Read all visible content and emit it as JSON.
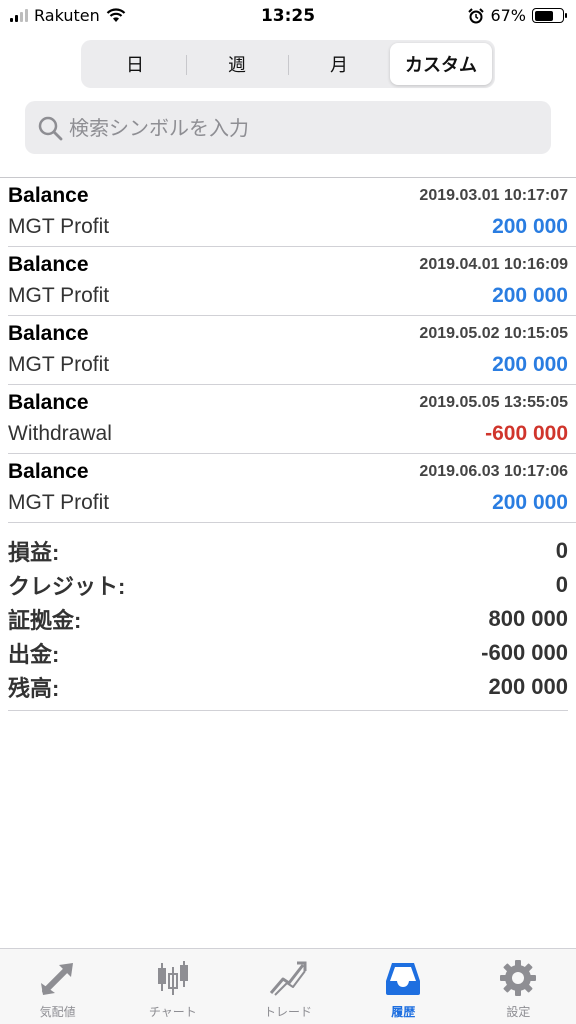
{
  "status_bar": {
    "carrier": "Rakuten",
    "time": "13:25",
    "battery": "67%",
    "battery_level": 0.67
  },
  "period_tabs": [
    {
      "label": "日",
      "active": false
    },
    {
      "label": "週",
      "active": false
    },
    {
      "label": "月",
      "active": false
    },
    {
      "label": "カスタム",
      "active": true
    }
  ],
  "search": {
    "placeholder": "検索シンボルを入力"
  },
  "deals": [
    {
      "type": "Balance",
      "time": "2019.03.01 10:17:07",
      "comment": "MGT Profit",
      "amount": "200 000",
      "sign": "pos"
    },
    {
      "type": "Balance",
      "time": "2019.04.01 10:16:09",
      "comment": "MGT Profit",
      "amount": "200 000",
      "sign": "pos"
    },
    {
      "type": "Balance",
      "time": "2019.05.02 10:15:05",
      "comment": "MGT Profit",
      "amount": "200 000",
      "sign": "pos"
    },
    {
      "type": "Balance",
      "time": "2019.05.05 13:55:05",
      "comment": "Withdrawal",
      "amount": "-600 000",
      "sign": "neg"
    },
    {
      "type": "Balance",
      "time": "2019.06.03 10:17:06",
      "comment": "MGT Profit",
      "amount": "200 000",
      "sign": "pos"
    }
  ],
  "summary": [
    {
      "label": "損益:",
      "value": "0"
    },
    {
      "label": "クレジット:",
      "value": "0"
    },
    {
      "label": "証拠金:",
      "value": "800 000"
    },
    {
      "label": "出金:",
      "value": "-600 000"
    },
    {
      "label": "残高:",
      "value": "200 000"
    }
  ],
  "tabbar": [
    {
      "label": "気配値",
      "icon": "quotes-icon",
      "active": false
    },
    {
      "label": "チャート",
      "icon": "chart-icon",
      "active": false
    },
    {
      "label": "トレード",
      "icon": "trade-icon",
      "active": false
    },
    {
      "label": "履歴",
      "icon": "history-icon",
      "active": true
    },
    {
      "label": "設定",
      "icon": "settings-icon",
      "active": false
    }
  ],
  "colors": {
    "positive": "#2a7de1",
    "negative": "#d0352c",
    "accent": "#1e6fe0",
    "inactive": "#8e8e93"
  }
}
